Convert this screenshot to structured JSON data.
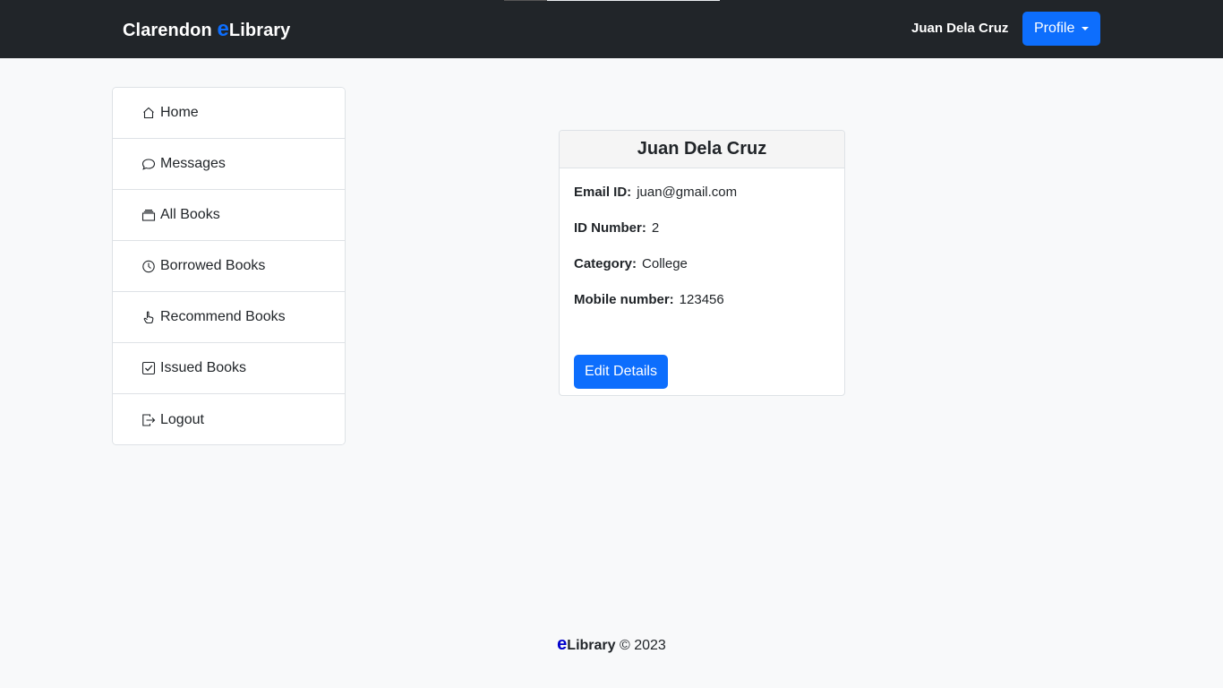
{
  "navbar": {
    "brand_prefix": "Clarendon ",
    "brand_e": "e",
    "brand_suffix": "Library",
    "user_name": "Juan Dela Cruz",
    "profile_label": "Profile",
    "brand_color": "#0d6efd"
  },
  "sidebar": {
    "items": [
      {
        "label": "Home",
        "icon": "house-icon"
      },
      {
        "label": "Messages",
        "icon": "chat-bubble-icon"
      },
      {
        "label": "All Books",
        "icon": "books-stack-icon"
      },
      {
        "label": "Borrowed Books",
        "icon": "clock-icon"
      },
      {
        "label": "Recommend Books",
        "icon": "hand-pointer-icon"
      },
      {
        "label": "Issued Books",
        "icon": "check-square-icon"
      },
      {
        "label": "Logout",
        "icon": "logout-icon"
      }
    ]
  },
  "profile_card": {
    "name": "Juan Dela Cruz",
    "fields": [
      {
        "label": "Email ID:",
        "value": "juan@gmail.com"
      },
      {
        "label": "ID Number:",
        "value": "2"
      },
      {
        "label": "Category:",
        "value": "College"
      },
      {
        "label": "Mobile number:",
        "value": "123456"
      }
    ],
    "edit_label": "Edit Details"
  },
  "footer": {
    "e": "e",
    "lib": "Library",
    "copyright": " © 2023"
  }
}
